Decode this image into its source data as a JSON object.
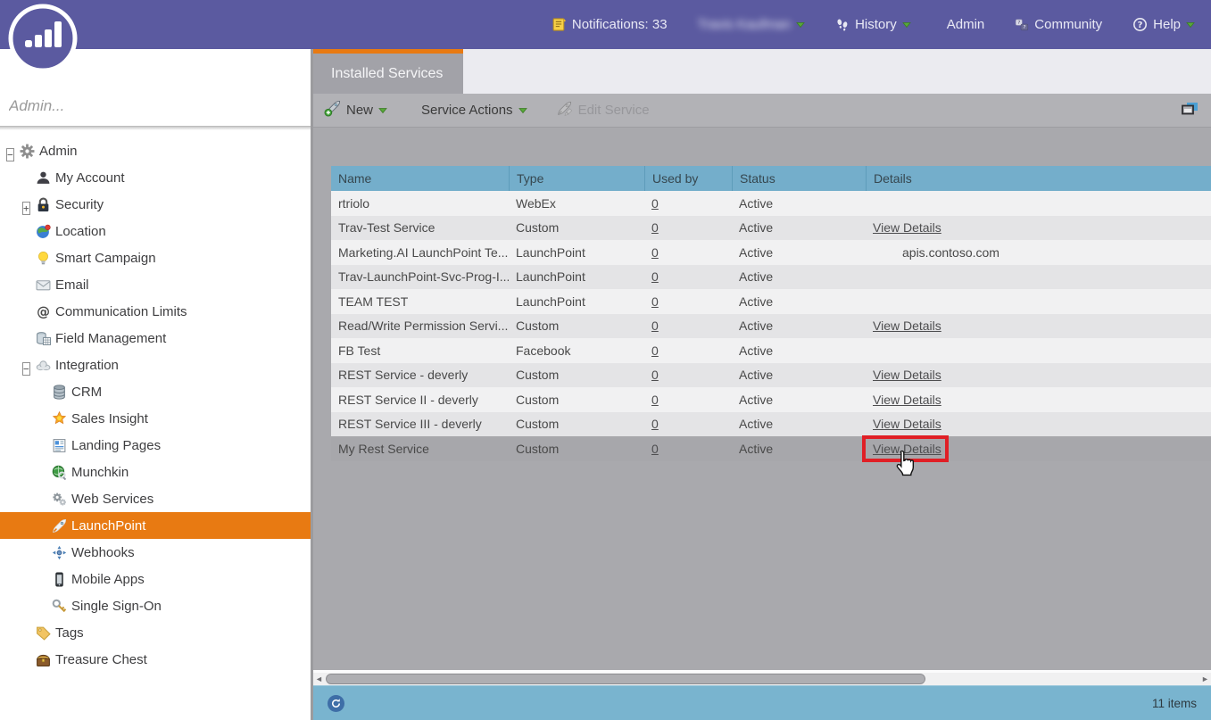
{
  "colors": {
    "topbar_purple": "#5b5aa0",
    "accent_orange": "#e87a12",
    "table_header_blue": "#74aecb",
    "footer_blue": "#79b4cf",
    "annotation_red": "#e01f26"
  },
  "topbar": {
    "nav": [
      {
        "label": "Notifications: 33",
        "icon": "notifications-icon",
        "caret": false,
        "blurred": false
      },
      {
        "label": "Travis Kaufman",
        "icon": null,
        "caret": true,
        "blurred": true
      },
      {
        "label": "History",
        "icon": "history-icon",
        "caret": true,
        "blurred": false
      },
      {
        "label": "Admin",
        "icon": "gear-icon",
        "caret": false,
        "blurred": false
      },
      {
        "label": "Community",
        "icon": "community-icon",
        "caret": false,
        "blurred": false
      },
      {
        "label": "Help",
        "icon": "help-icon",
        "caret": true,
        "blurred": false
      }
    ]
  },
  "sidebar": {
    "search_placeholder": "Admin...",
    "tree": [
      {
        "label": "Admin",
        "icon": "gear-icon",
        "level": 0,
        "expander": "minus",
        "selected": false
      },
      {
        "label": "My Account",
        "icon": "person-icon",
        "level": 1,
        "expander": null,
        "selected": false
      },
      {
        "label": "Security",
        "icon": "lock-icon",
        "level": 1,
        "expander": "plus",
        "selected": false
      },
      {
        "label": "Location",
        "icon": "globe-marker-icon",
        "level": 1,
        "expander": null,
        "selected": false
      },
      {
        "label": "Smart Campaign",
        "icon": "lightbulb-icon",
        "level": 1,
        "expander": null,
        "selected": false
      },
      {
        "label": "Email",
        "icon": "envelope-icon",
        "level": 1,
        "expander": null,
        "selected": false
      },
      {
        "label": "Communication Limits",
        "icon": "at-sign-icon",
        "level": 1,
        "expander": null,
        "selected": false
      },
      {
        "label": "Field Management",
        "icon": "field-table-icon",
        "level": 1,
        "expander": null,
        "selected": false
      },
      {
        "label": "Integration",
        "icon": "cloud-icon",
        "level": 1,
        "expander": "minus",
        "selected": false
      },
      {
        "label": "CRM",
        "icon": "database-icon",
        "level": 2,
        "expander": null,
        "selected": false
      },
      {
        "label": "Sales Insight",
        "icon": "sales-star-icon",
        "level": 2,
        "expander": null,
        "selected": false
      },
      {
        "label": "Landing Pages",
        "icon": "landing-pages-icon",
        "level": 2,
        "expander": null,
        "selected": false
      },
      {
        "label": "Munchkin",
        "icon": "munchkin-globe-icon",
        "level": 2,
        "expander": null,
        "selected": false
      },
      {
        "label": "Web Services",
        "icon": "gears-icon",
        "level": 2,
        "expander": null,
        "selected": false
      },
      {
        "label": "LaunchPoint",
        "icon": "rocket-icon",
        "level": 2,
        "expander": null,
        "selected": true
      },
      {
        "label": "Webhooks",
        "icon": "webhook-icon",
        "level": 2,
        "expander": null,
        "selected": false
      },
      {
        "label": "Mobile Apps",
        "icon": "mobile-icon",
        "level": 2,
        "expander": null,
        "selected": false
      },
      {
        "label": "Single Sign-On",
        "icon": "key-icon",
        "level": 2,
        "expander": null,
        "selected": false
      },
      {
        "label": "Tags",
        "icon": "tag-icon",
        "level": 1,
        "expander": null,
        "selected": false
      },
      {
        "label": "Treasure Chest",
        "icon": "chest-icon",
        "level": 1,
        "expander": null,
        "selected": false
      }
    ]
  },
  "tab": {
    "label": "Installed Services"
  },
  "toolbar": {
    "buttons": [
      {
        "label": "New",
        "icon": "rocket-plus-icon",
        "caret": true,
        "disabled": false
      },
      {
        "label": "Service Actions",
        "icon": "rocket-icon",
        "caret": true,
        "disabled": false
      },
      {
        "label": "Edit Service",
        "icon": "rocket-edit-icon",
        "caret": false,
        "disabled": true
      }
    ]
  },
  "table": {
    "columns": [
      "Name",
      "Type",
      "Used by",
      "Status",
      "Details"
    ],
    "rows": [
      {
        "name": "rtriolo",
        "type": "WebEx",
        "used_by": "0",
        "status": "Active",
        "details": "",
        "details_kind": "none",
        "selected": false
      },
      {
        "name": "Trav-Test Service",
        "type": "Custom",
        "used_by": "0",
        "status": "Active",
        "details": "View Details",
        "details_kind": "link",
        "selected": false
      },
      {
        "name": "Marketing.AI LaunchPoint Te...",
        "type": "LaunchPoint",
        "used_by": "0",
        "status": "Active",
        "details": "apis.contoso.com",
        "details_kind": "text",
        "selected": false
      },
      {
        "name": "Trav-LaunchPoint-Svc-Prog-I...",
        "type": "LaunchPoint",
        "used_by": "0",
        "status": "Active",
        "details": "",
        "details_kind": "none",
        "selected": false
      },
      {
        "name": "TEAM TEST",
        "type": "LaunchPoint",
        "used_by": "0",
        "status": "Active",
        "details": "",
        "details_kind": "none",
        "selected": false
      },
      {
        "name": "Read/Write Permission Servi...",
        "type": "Custom",
        "used_by": "0",
        "status": "Active",
        "details": "View Details",
        "details_kind": "link",
        "selected": false
      },
      {
        "name": "FB Test",
        "type": "Facebook",
        "used_by": "0",
        "status": "Active",
        "details": "",
        "details_kind": "none",
        "selected": false
      },
      {
        "name": "REST Service - deverly",
        "type": "Custom",
        "used_by": "0",
        "status": "Active",
        "details": "View Details",
        "details_kind": "link",
        "selected": false
      },
      {
        "name": "REST Service II - deverly",
        "type": "Custom",
        "used_by": "0",
        "status": "Active",
        "details": "View Details",
        "details_kind": "link",
        "selected": false
      },
      {
        "name": "REST Service III - deverly",
        "type": "Custom",
        "used_by": "0",
        "status": "Active",
        "details": "View Details",
        "details_kind": "link",
        "selected": false
      },
      {
        "name": "My Rest Service",
        "type": "Custom",
        "used_by": "0",
        "status": "Active",
        "details": "View Details",
        "details_kind": "link",
        "selected": true
      }
    ]
  },
  "footer": {
    "items_label": "11 items"
  }
}
